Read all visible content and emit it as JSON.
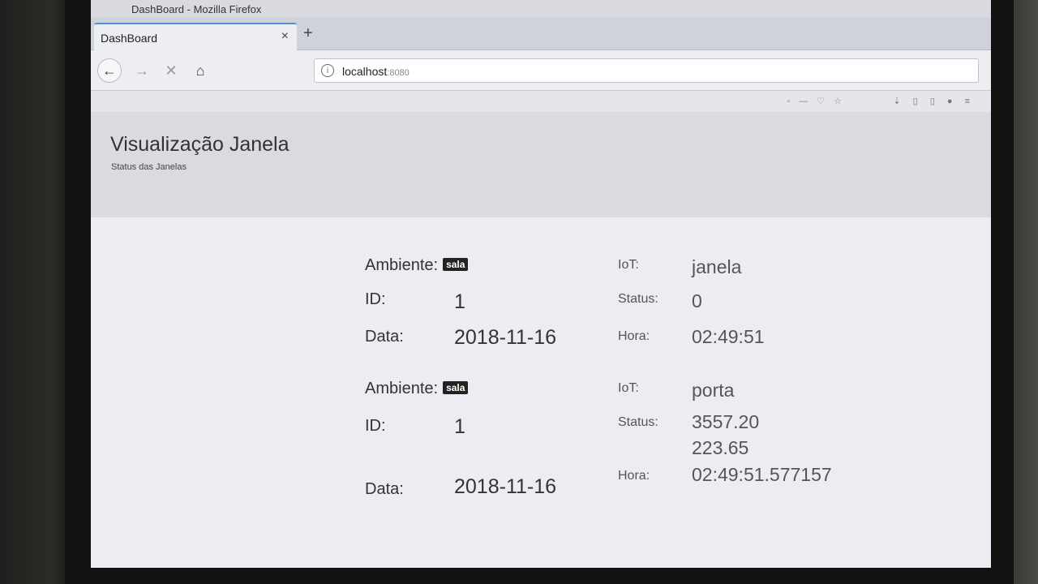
{
  "window": {
    "title": "DashBoard - Mozilla Firefox"
  },
  "tab": {
    "title": "DashBoard",
    "close": "×",
    "new_tab": "+"
  },
  "nav": {
    "back": "←",
    "forward": "→",
    "stop": "✕",
    "home": "⌂"
  },
  "url": {
    "info": "i",
    "host": "localhost",
    "port": ":8080"
  },
  "page": {
    "title": "Visualização Janela",
    "subtitle": "Status das Janelas"
  },
  "records": [
    {
      "ambiente_label": "Ambiente:",
      "ambiente": "sala",
      "id_label": "ID:",
      "id": "1",
      "data_label": "Data:",
      "data": "2018-11-16",
      "iot_label": "IoT:",
      "iot": "janela",
      "status_label": "Status:",
      "status": "0",
      "status2": "",
      "hora_label": "Hora:",
      "hora": "02:49:51"
    },
    {
      "ambiente_label": "Ambiente:",
      "ambiente": "sala",
      "id_label": "ID:",
      "id": "1",
      "data_label": "Data:",
      "data": "2018-11-16",
      "iot_label": "IoT:",
      "iot": "porta",
      "status_label": "Status:",
      "status": "3557.20",
      "status2": "223.65",
      "hora_label": "Hora:",
      "hora": "02:49:51.577157"
    }
  ]
}
